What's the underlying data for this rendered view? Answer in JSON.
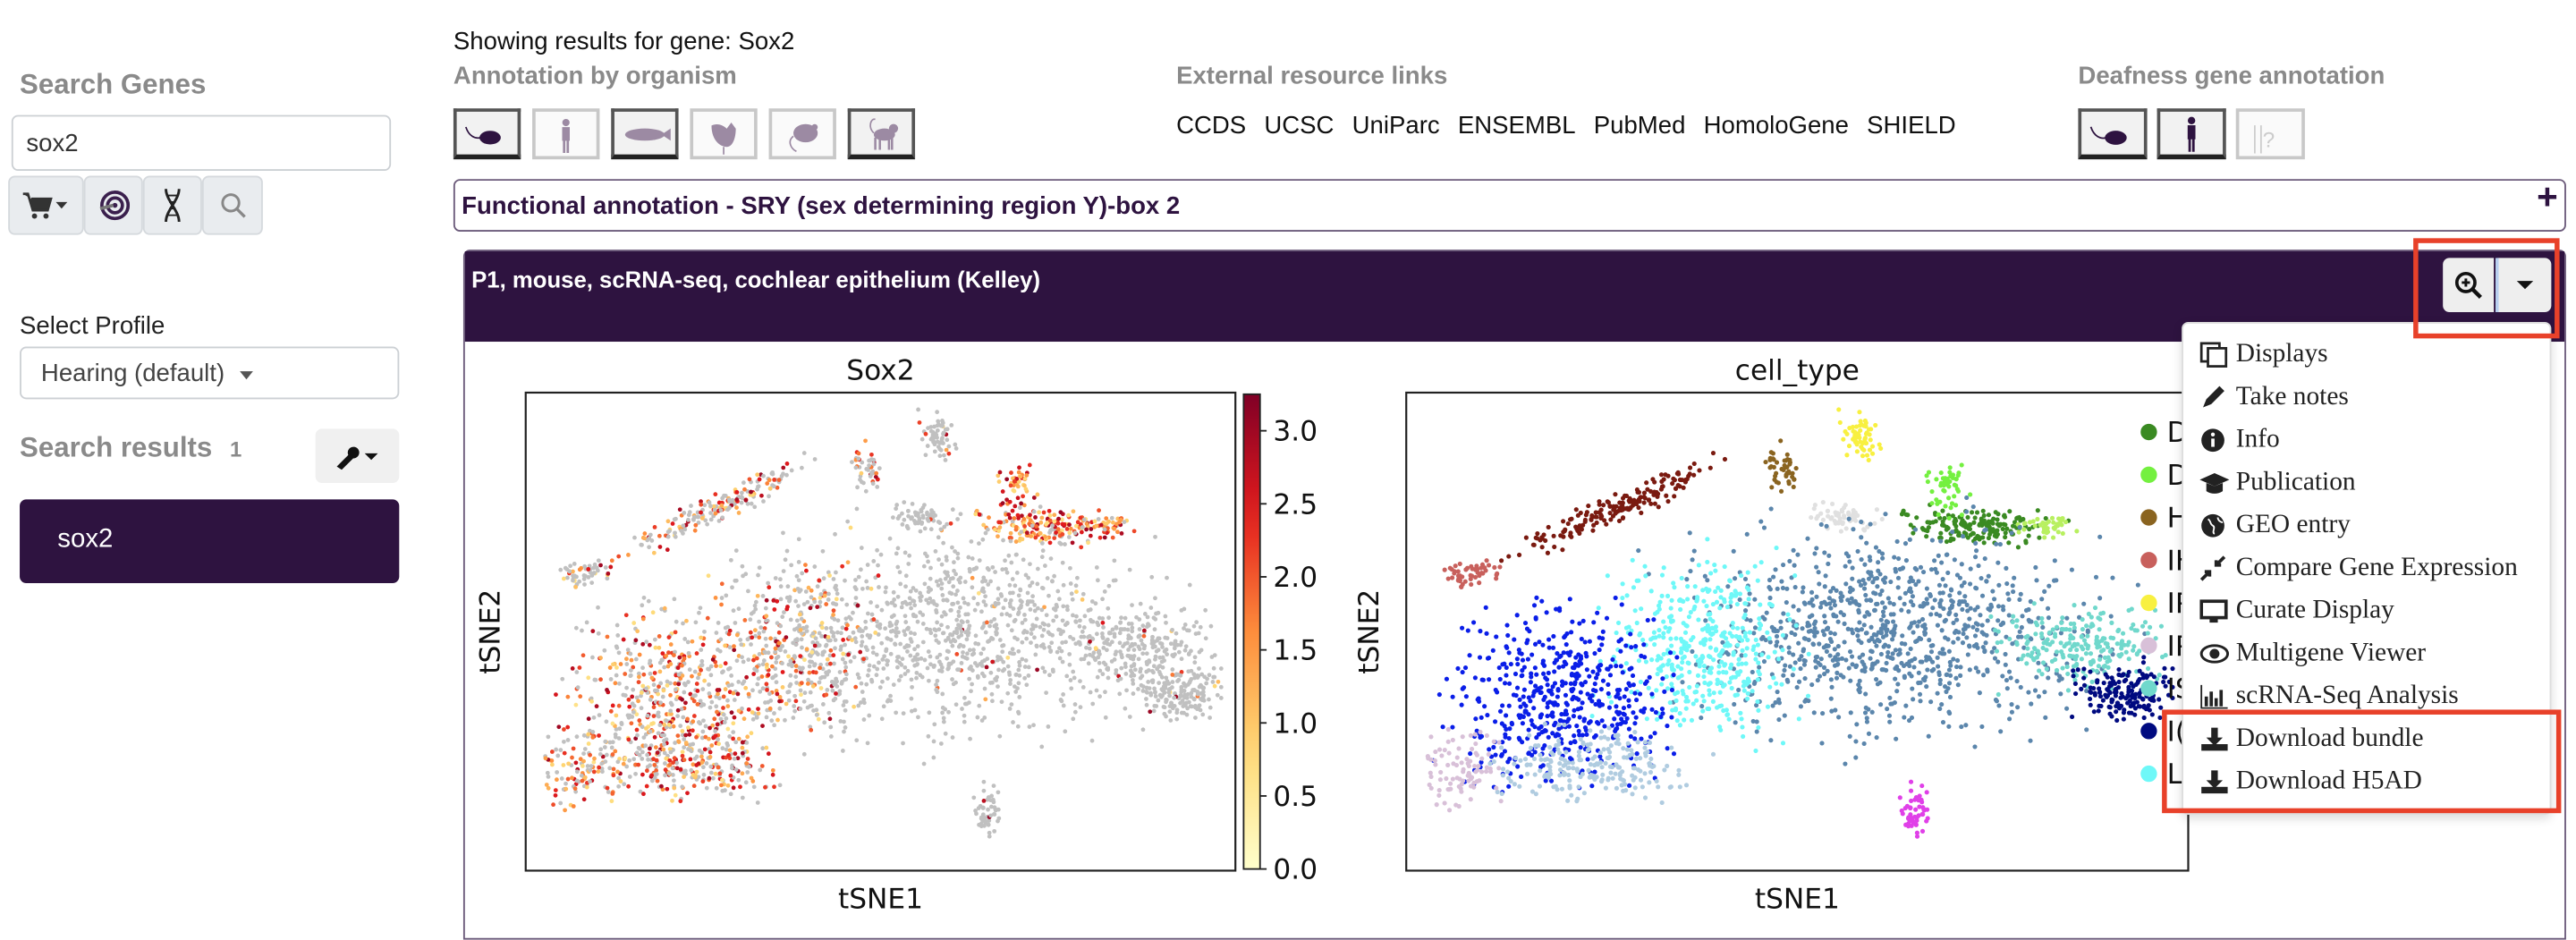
{
  "sidebar": {
    "search_genes_label": "Search Genes",
    "search_value": "sox2",
    "tool_buttons": [
      "cart-icon",
      "target-icon",
      "dna-icon",
      "search-icon"
    ],
    "select_profile_label": "Select Profile",
    "profile_value": "Hearing (default)",
    "search_results_label": "Search results",
    "search_results_count": "1",
    "results": [
      {
        "label": "sox2"
      }
    ]
  },
  "header": {
    "showing_results": "Showing results for gene: Sox2",
    "annotation_by_organism": "Annotation by organism",
    "organisms": [
      {
        "name": "mouse",
        "active": true
      },
      {
        "name": "human",
        "active": false
      },
      {
        "name": "zebrafish",
        "active": true
      },
      {
        "name": "chicken",
        "active": false
      },
      {
        "name": "rat",
        "active": false
      },
      {
        "name": "marmoset",
        "active": true
      }
    ],
    "external_links_label": "External resource links",
    "external_links": [
      "CCDS",
      "UCSC",
      "UniParc",
      "ENSEMBL",
      "PubMed",
      "HomoloGene",
      "SHIELD"
    ],
    "deafness_label": "Deafness gene annotation",
    "deafness": [
      {
        "name": "mouse",
        "active": true
      },
      {
        "name": "human",
        "active": true
      },
      {
        "name": "unknown",
        "active": false
      }
    ]
  },
  "functional_annotation": {
    "title": "Functional annotation - SRY (sex determining region Y)-box 2",
    "expand": "+"
  },
  "dataset": {
    "title": "P1, mouse, scRNA-seq, cochlear epithelium (Kelley)",
    "menu": [
      {
        "label": "Displays",
        "icon": "copy-icon"
      },
      {
        "label": "Take notes",
        "icon": "pencil-icon"
      },
      {
        "label": "Info",
        "icon": "info-icon"
      },
      {
        "label": "Publication",
        "icon": "graduation-cap-icon"
      },
      {
        "label": "GEO entry",
        "icon": "globe-icon"
      },
      {
        "label": "Compare Gene Expression",
        "icon": "compress-icon"
      },
      {
        "label": "Curate Display",
        "icon": "desktop-icon"
      },
      {
        "label": "Multigene Viewer",
        "icon": "eye-icon"
      },
      {
        "label": "scRNA-Seq Analysis",
        "icon": "bar-chart-icon"
      },
      {
        "label": "Download bundle",
        "icon": "download-icon"
      },
      {
        "label": "Download H5AD",
        "icon": "download-icon"
      }
    ]
  },
  "highlight_color": "#e8412a",
  "brand_color": "#2e1340",
  "chart_data": [
    {
      "type": "scatter",
      "title": "Sox2",
      "xlabel": "tSNE1",
      "ylabel": "tSNE2",
      "colorbar": {
        "colormap": "YlOrRd",
        "range": [
          0,
          3.25
        ],
        "ticks": [
          "0.0",
          "0.5",
          "1.0",
          "1.5",
          "2.0",
          "2.5",
          "3.0"
        ]
      },
      "zero_color": "#c0c0c0",
      "grid": false
    },
    {
      "type": "scatter",
      "title": "cell_type",
      "xlabel": "tSNE1",
      "ylabel": "tSNE2",
      "grid": false,
      "legend_placement": "right",
      "legend": [
        {
          "label": "D",
          "color": "#3a8a22"
        },
        {
          "label": "D",
          "color": "#74f040"
        },
        {
          "label": "H",
          "color": "#8a6420"
        },
        {
          "label": "IH",
          "color": "#c8605c"
        },
        {
          "label": "IP",
          "color": "#f8f040"
        },
        {
          "label": "IP",
          "color": "#d8c0d8"
        },
        {
          "label": "IS",
          "color": "#70d8cc"
        },
        {
          "label": "I(",
          "color": "#000a80"
        },
        {
          "label": "L",
          "color": "#6ef8f8"
        }
      ]
    }
  ]
}
